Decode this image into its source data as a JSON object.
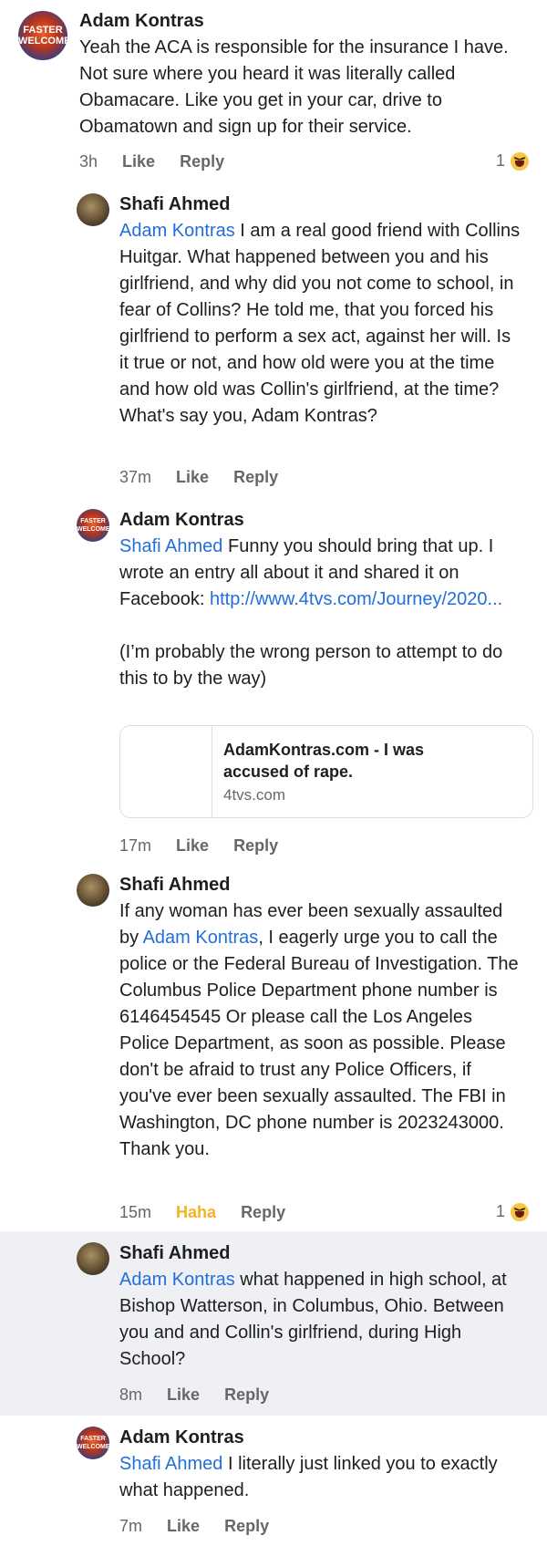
{
  "comments": [
    {
      "author": "Adam Kontras",
      "avatar_text": [
        "FASTER",
        "WELCOME"
      ],
      "body": "Yeah the ACA is responsible for the insurance I have.  Not sure where you heard it was literally called Obamacare.  Like you get in your car, drive to Obamatown and sign up for their service.",
      "time": "3h",
      "like": "Like",
      "reply": "Reply",
      "reaction_count": "1",
      "reaction_icon": "haha-emoji-icon"
    },
    {
      "author": "Shafi Ahmed",
      "mention": "Adam Kontras",
      "body": " I am a real good friend with Collins Huitgar.  What happened between you and his girlfriend, and why did you not come to school, in fear of Collins?  He told me, that you forced his girlfriend to perform a sex act, against her will.  Is it true or not, and how old were you at the time and how old was Collin's girlfriend, at the time?  What's say you, Adam Kontras?",
      "time": "37m",
      "like": "Like",
      "reply": "Reply"
    },
    {
      "author": "Adam Kontras",
      "avatar_text": [
        "FASTER",
        "WELCOME"
      ],
      "mention": "Shafi Ahmed",
      "body": " Funny you should bring that up.  I wrote an entry all about it and shared it on Facebook: ",
      "link": "http://www.4tvs.com/Journey/2020...",
      "body2": "(I’m probably the wrong person to attempt to do this to by the way)",
      "card_title": "AdamKontras.com - I was accused of rape.",
      "card_domain": "4tvs.com",
      "time": "17m",
      "like": "Like",
      "reply": "Reply"
    },
    {
      "author": "Shafi Ahmed",
      "body_a": "If any woman has ever been sexually assaulted by ",
      "mention": "Adam Kontras",
      "body_b": ", I eagerly urge you to call the police or the Federal Bureau of Investigation.  The Columbus Police Department phone number is 6146454545 Or please call the Los Angeles Police Department, as soon as possible.  Please don't be afraid to trust any Police Officers, if you've ever been sexually assaulted.  The FBI in Washington, DC phone number is 2023243000.  Thank you.",
      "time": "15m",
      "like": "Haha",
      "reply": "Reply",
      "reaction_count": "1",
      "reaction_icon": "haha-emoji-icon"
    },
    {
      "author": "Shafi Ahmed",
      "mention": "Adam Kontras",
      "body": " what happened in high school, at Bishop Watterson, in Columbus, Ohio. Between you and and Collin's girlfriend, during High School?",
      "time": "8m",
      "like": "Like",
      "reply": "Reply"
    },
    {
      "author": "Adam Kontras",
      "avatar_text": [
        "FASTER",
        "WELCOME"
      ],
      "mention": "Shafi Ahmed",
      "body": " I literally just linked you to exactly what happened.",
      "time": "7m",
      "like": "Like",
      "reply": "Reply"
    }
  ],
  "colors": {
    "mention": "#216fdb",
    "meta": "#65676b",
    "haha": "#f7b125",
    "highlight": "#eef0f3"
  }
}
